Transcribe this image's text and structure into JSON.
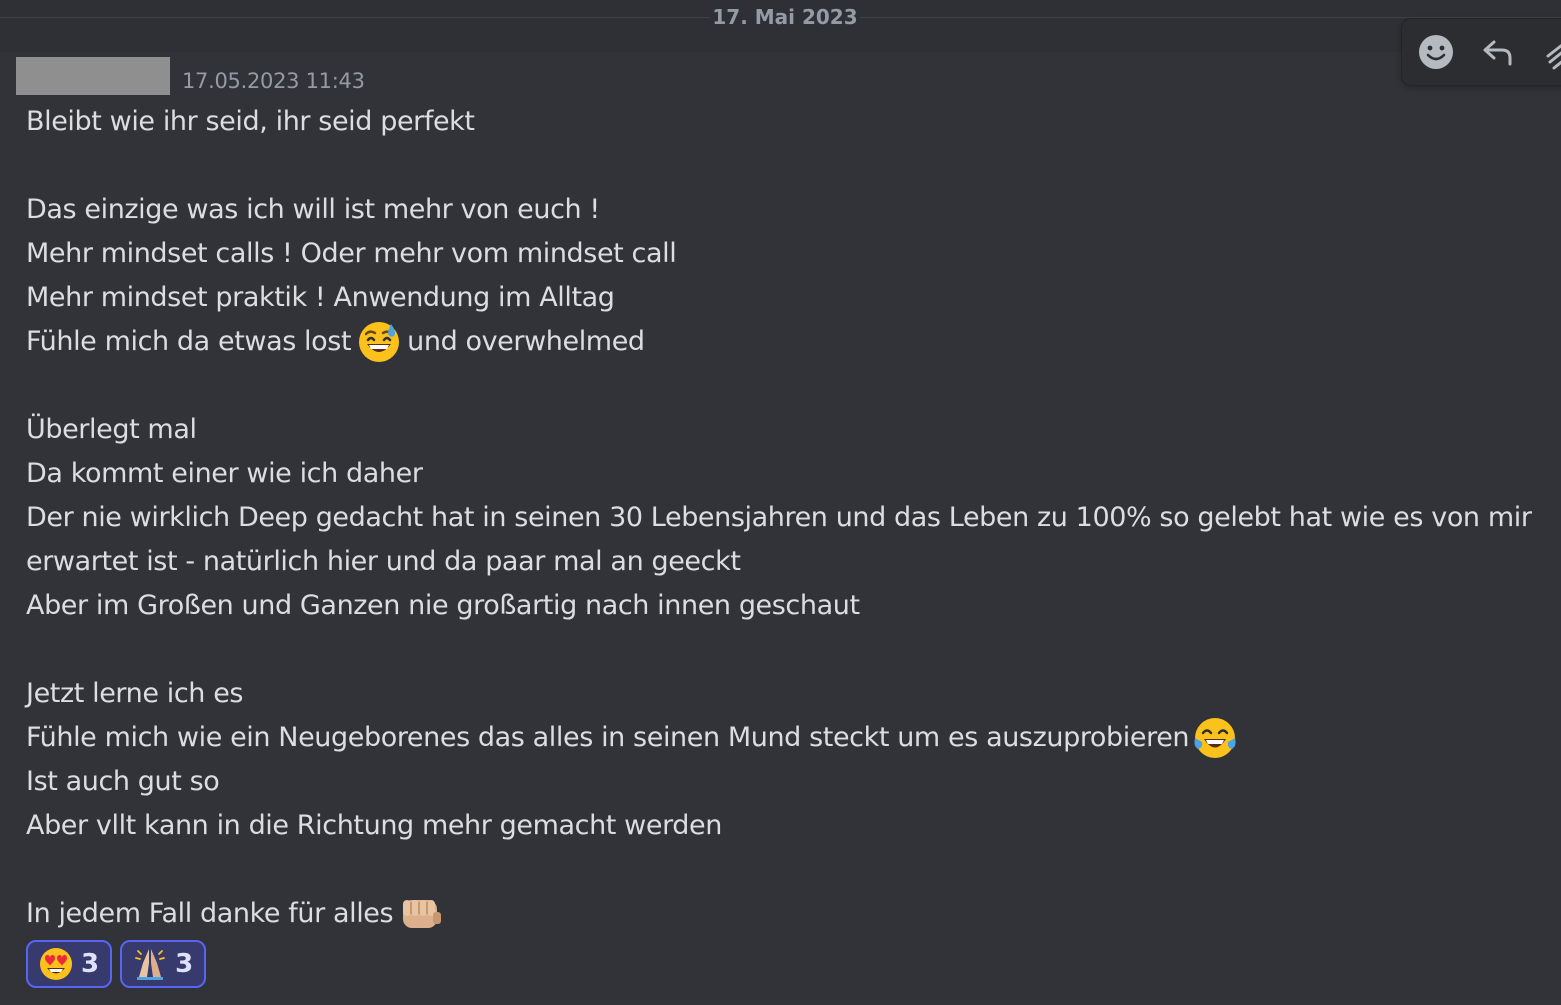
{
  "date_divider": {
    "label": "17. Mai 2023"
  },
  "message": {
    "timestamp": "17.05.2023 11:43",
    "lines": [
      {
        "text": "Bleibt wie ihr seid, ihr seid perfekt"
      },
      {
        "text": ""
      },
      {
        "text": "Das einzige was ich will ist mehr von euch !"
      },
      {
        "text": "Mehr mindset calls ! Oder mehr vom mindset call"
      },
      {
        "text": "Mehr mindset praktik ! Anwendung im Alltag"
      },
      {
        "text": "Fühle mich da etwas lost",
        "emoji": "grinning-sweat-emoji",
        "after": "und overwhelmed"
      },
      {
        "text": ""
      },
      {
        "text": "Überlegt mal"
      },
      {
        "text": "Da kommt einer wie ich daher"
      },
      {
        "text": "Der nie wirklich Deep gedacht hat in seinen 30 Lebensjahren und das Leben zu 100% so gelebt hat wie es von mir"
      },
      {
        "text": "erwartet ist - natürlich hier und da paar mal an geeckt"
      },
      {
        "text": "Aber im Großen und Ganzen nie großartig nach innen geschaut"
      },
      {
        "text": ""
      },
      {
        "text": "Jetzt lerne ich es"
      },
      {
        "text": "Fühle mich wie ein Neugeborenes das alles in seinen Mund steckt um es auszuprobieren",
        "emoji": "tears-of-joy-emoji",
        "after": ""
      },
      {
        "text": "Ist auch gut so"
      },
      {
        "text": "Aber vllt kann in die Richtung mehr gemacht werden"
      },
      {
        "text": ""
      },
      {
        "text": "In jedem Fall danke für alles",
        "emoji": "fist-bump-emoji",
        "after": ""
      }
    ]
  },
  "reactions": [
    {
      "emoji": "heart-eyes-emoji",
      "count": "3"
    },
    {
      "emoji": "folded-hands-emoji",
      "count": "3"
    }
  ],
  "toolbar": {
    "icons": [
      "smiley-icon",
      "reply-icon",
      "more-icon"
    ]
  },
  "colors": {
    "background": "#313338",
    "text": "#dbdee1",
    "muted": "#949ba4",
    "reaction_bg": "#373a6d",
    "reaction_border": "#5865f2"
  }
}
